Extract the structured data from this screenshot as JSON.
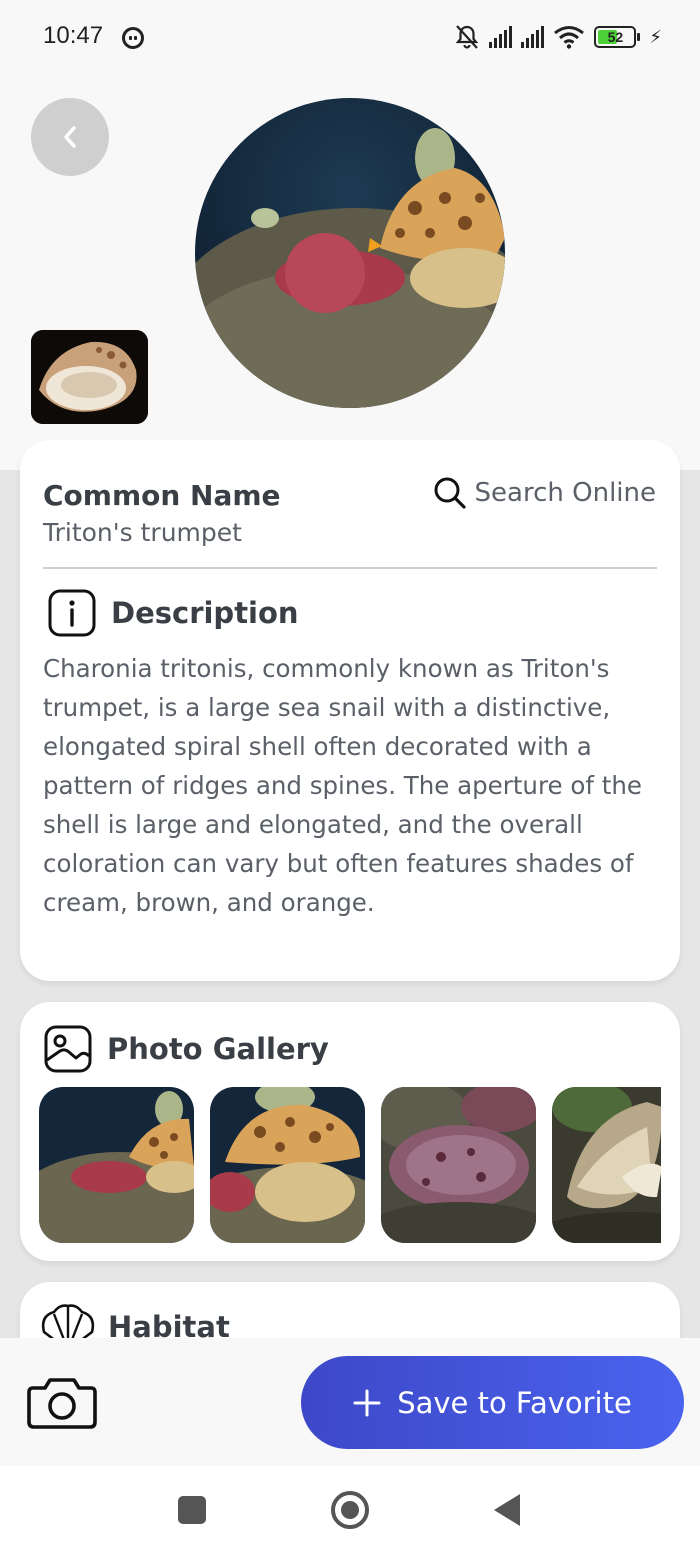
{
  "status_bar": {
    "time": "10:47",
    "battery": "52"
  },
  "header": {
    "back_icon": "chevron-left-icon",
    "main_photo": "triton-trumpet-on-starfish",
    "thumbnail": "triton-shell-thumbnail",
    "carousel_dot_color": "#f7b631"
  },
  "info": {
    "common_name_label": "Common Name",
    "common_name_value": "Triton's trumpet",
    "search_label": "Search Online",
    "description_title": "Description",
    "description_text": "Charonia tritonis, commonly known as Triton's trumpet, is a large sea snail with a distinctive, elongated spiral shell often decorated with a pattern of ridges and spines. The aperture of the shell is large and elongated, and the overall coloration can vary but often features shades of cream, brown, and orange."
  },
  "gallery": {
    "title": "Photo Gallery",
    "photos": [
      "triton-on-starfish-1",
      "triton-on-starfish-2",
      "purple-starfish",
      "triton-shell-aperture"
    ]
  },
  "habitat": {
    "title": "Habitat"
  },
  "actions": {
    "save_label": "Save to Favorite",
    "accent_color": "#4356e0"
  }
}
